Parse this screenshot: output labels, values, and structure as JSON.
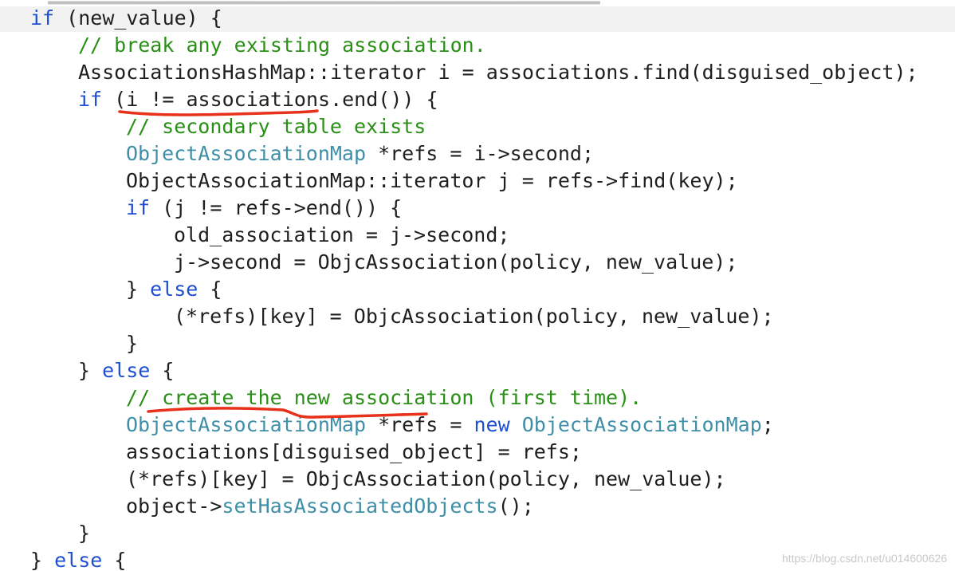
{
  "colors": {
    "keyword": "#1e4fd1",
    "type": "#3f8fa8",
    "comment": "#2a8f16",
    "function": "#3f8fa8",
    "plain": "#1f1f1f",
    "annotation": "#e8311a"
  },
  "code_lines": [
    [
      {
        "t": "if",
        "c": "kw"
      },
      {
        "t": " (new_value) {",
        "c": "plain"
      }
    ],
    [
      {
        "t": "// break any existing association.",
        "c": "cmt"
      }
    ],
    [
      {
        "t": "AssociationsHashMap::iterator i = associations.find(disguised_object);",
        "c": "plain"
      }
    ],
    [
      {
        "t": "if",
        "c": "kw"
      },
      {
        "t": " (i != associations.end()) {",
        "c": "plain"
      }
    ],
    [
      {
        "t": "// secondary table exists",
        "c": "cmt"
      }
    ],
    [
      {
        "t": "ObjectAssociationMap",
        "c": "type"
      },
      {
        "t": " *refs = i->second;",
        "c": "plain"
      }
    ],
    [
      {
        "t": "ObjectAssociationMap::iterator j = refs->find(key);",
        "c": "plain"
      }
    ],
    [
      {
        "t": "if",
        "c": "kw"
      },
      {
        "t": " (j != refs->end()) {",
        "c": "plain"
      }
    ],
    [
      {
        "t": "old_association = j->second;",
        "c": "plain"
      }
    ],
    [
      {
        "t": "j->second = ObjcAssociation(policy, new_value);",
        "c": "plain"
      }
    ],
    [
      {
        "t": "} ",
        "c": "plain"
      },
      {
        "t": "else",
        "c": "kw"
      },
      {
        "t": " {",
        "c": "plain"
      }
    ],
    [
      {
        "t": "(*refs)[key] = ObjcAssociation(policy, new_value);",
        "c": "plain"
      }
    ],
    [
      {
        "t": "}",
        "c": "plain"
      }
    ],
    [
      {
        "t": "} ",
        "c": "plain"
      },
      {
        "t": "else",
        "c": "kw"
      },
      {
        "t": " {",
        "c": "plain"
      }
    ],
    [
      {
        "t": "// create the new association (first time).",
        "c": "cmt"
      }
    ],
    [
      {
        "t": "ObjectAssociationMap",
        "c": "type"
      },
      {
        "t": " *refs = ",
        "c": "plain"
      },
      {
        "t": "new",
        "c": "kw"
      },
      {
        "t": " ",
        "c": "plain"
      },
      {
        "t": "ObjectAssociationMap",
        "c": "type"
      },
      {
        "t": ";",
        "c": "plain"
      }
    ],
    [
      {
        "t": "associations[disguised_object] = refs;",
        "c": "plain"
      }
    ],
    [
      {
        "t": "(*refs)[key] = ObjcAssociation(policy, new_value);",
        "c": "plain"
      }
    ],
    [
      {
        "t": "object->",
        "c": "plain"
      },
      {
        "t": "setHasAssociatedObjects",
        "c": "fn"
      },
      {
        "t": "();",
        "c": "plain"
      }
    ],
    [
      {
        "t": "}",
        "c": "plain"
      }
    ],
    [
      {
        "t": "} ",
        "c": "plain"
      },
      {
        "t": "else",
        "c": "kw"
      },
      {
        "t": " {",
        "c": "plain"
      }
    ]
  ],
  "watermark": "https://blog.csdn.net/u014600626"
}
